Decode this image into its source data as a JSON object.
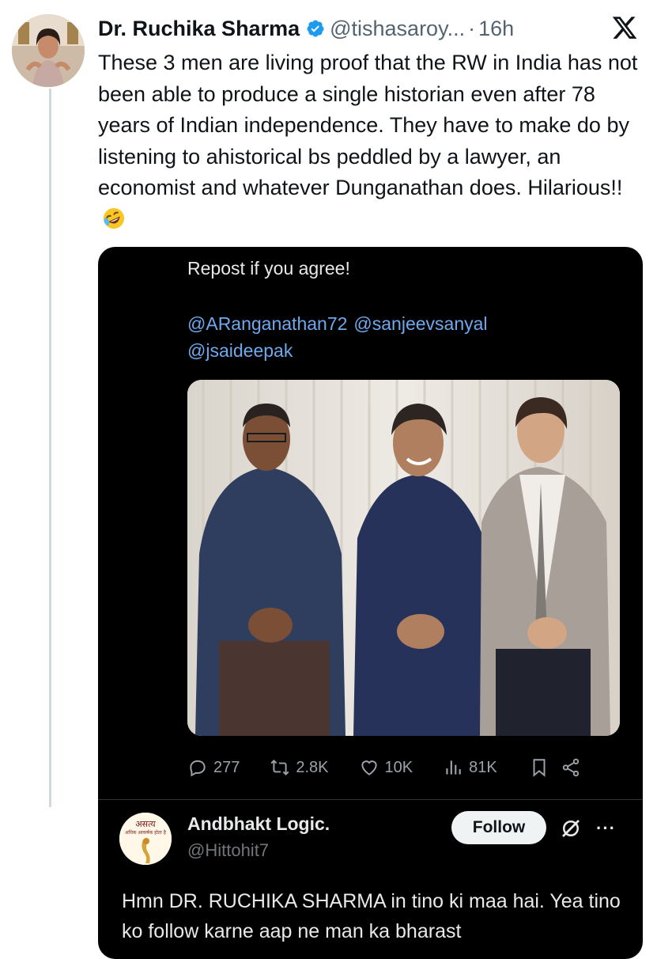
{
  "post": {
    "author_name": "Dr. Ruchika Sharma",
    "author_handle": "@tishasaroy...",
    "separator": "·",
    "time": "16h",
    "text": "These 3 men are living proof that the RW in India has not been able to produce a single historian even after 78 years of Indian independence. They have to make do by listening to ahistorical bs peddled by a lawyer, an economist and whatever Dunganathan does. Hilarious!!",
    "emoji": "rolling-on-floor-laughing-emoji"
  },
  "quoted": {
    "text": "Repost if you agree!",
    "mentions": [
      "@ARanganathan72",
      "@sanjeevsanyal",
      "@jsaideepak"
    ],
    "stats": {
      "replies": "277",
      "reposts": "2.8K",
      "likes": "10K",
      "views": "81K"
    }
  },
  "reply": {
    "author_name": "Andbhakt Logic.",
    "author_handle": "@Hittohit7",
    "follow_label": "Follow",
    "more_label": "···",
    "text": "Hmn DR. RUCHIKA SHARMA in tino ki maa hai. Yea tino ko follow karne aap ne man ka bharast",
    "avatar_text": "असत्य",
    "avatar_subtext": "अधिक आकर्षक होता है"
  },
  "colors": {
    "link": "#6ea9ee",
    "verified": "#1d9bf0",
    "muted": "#536471"
  }
}
